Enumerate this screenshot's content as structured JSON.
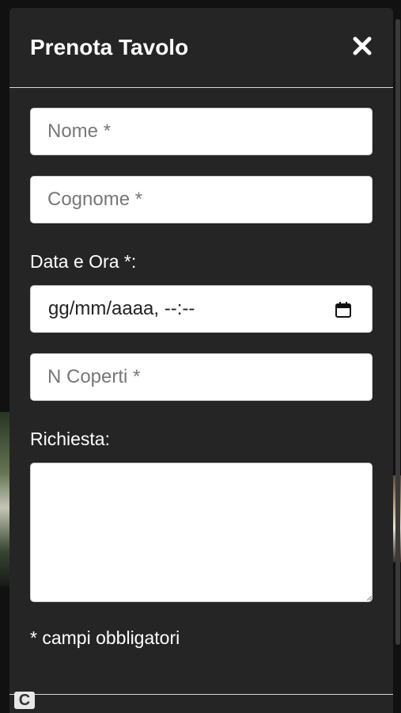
{
  "modal": {
    "title": "Prenota Tavolo"
  },
  "icons": {
    "close": "close-icon",
    "calendar": "calendar-icon"
  },
  "form": {
    "nome_placeholder": "Nome *",
    "cognome_placeholder": "Cognome *",
    "datetime_label": "Data e Ora *:",
    "datetime_value": "gg/mm/aaaa, --:--",
    "coperti_placeholder": "N Coperti *",
    "richiesta_label": "Richiesta:",
    "note": "* campi obbligatori"
  },
  "badge": {
    "letter": "C"
  },
  "colors": {
    "modal_bg": "#252525",
    "field_bg": "#ffffff",
    "text": "#ffffff"
  }
}
